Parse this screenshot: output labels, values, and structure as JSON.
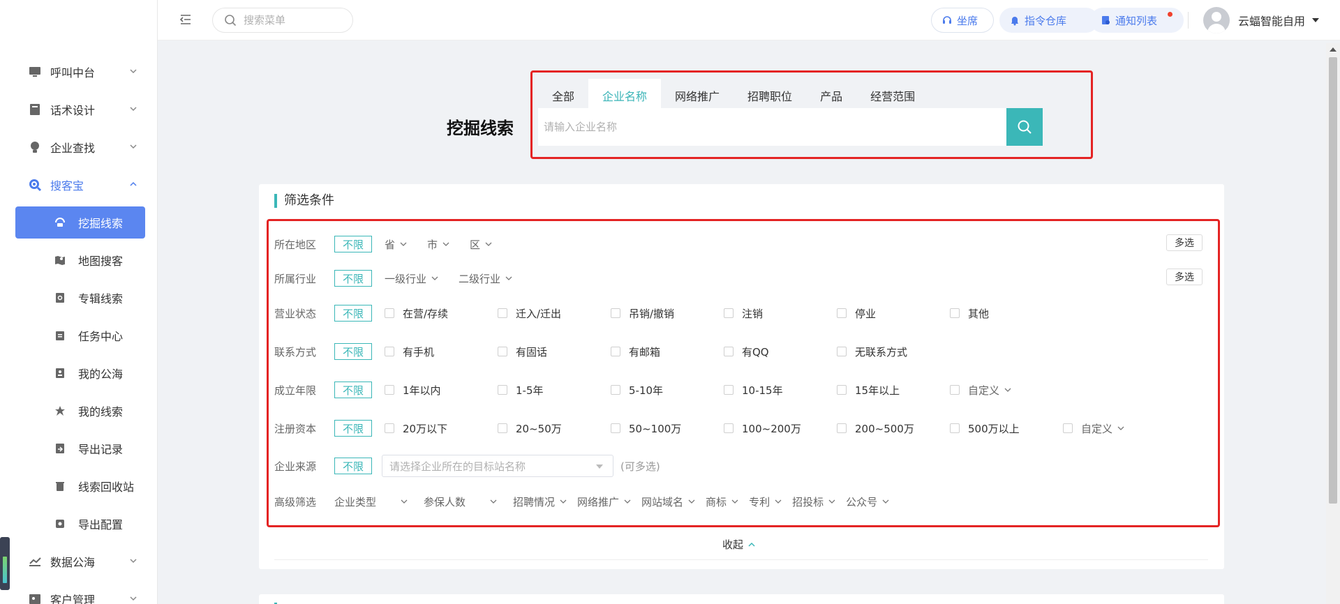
{
  "sidebar": {
    "menu": [
      {
        "label": "呼叫中台",
        "icon": "monitor-icon"
      },
      {
        "label": "话术设计",
        "icon": "book-icon"
      },
      {
        "label": "企业查找",
        "icon": "bulb-icon"
      },
      {
        "label": "搜客宝",
        "icon": "search-circle-icon",
        "open": true
      }
    ],
    "submenu": [
      {
        "label": "挖掘线索",
        "icon": "signal-icon",
        "active": true
      },
      {
        "label": "地图搜客",
        "icon": "map-icon"
      },
      {
        "label": "专辑线索",
        "icon": "doc-search-icon"
      },
      {
        "label": "任务中心",
        "icon": "clipboard-icon"
      },
      {
        "label": "我的公海",
        "icon": "contact-card-icon"
      },
      {
        "label": "我的线索",
        "icon": "star-icon"
      },
      {
        "label": "导出记录",
        "icon": "export-doc-icon"
      },
      {
        "label": "线索回收站",
        "icon": "trash-icon"
      },
      {
        "label": "导出配置",
        "icon": "config-icon"
      }
    ],
    "menu_after": [
      {
        "label": "数据公海",
        "icon": "chart-line-icon"
      },
      {
        "label": "客户管理",
        "icon": "customer-icon"
      }
    ]
  },
  "topbar": {
    "search_placeholder": "搜索菜单",
    "seat_label": "坐席",
    "command_label": "指令仓库",
    "notice_label": "通知列表",
    "username": "云蝠智能自用"
  },
  "hero": {
    "title": "挖掘线索",
    "tabs": [
      "全部",
      "企业名称",
      "网络推广",
      "招聘职位",
      "产品",
      "经营范围"
    ],
    "active_tab": "企业名称",
    "search_placeholder": "请输入企业名称"
  },
  "filters": {
    "title": "筛选条件",
    "unlimited": "不限",
    "multi_select": "多选",
    "region": {
      "label": "所在地区",
      "dropdowns": [
        "省",
        "市",
        "区"
      ]
    },
    "industry": {
      "label": "所属行业",
      "dropdowns": [
        "一级行业",
        "二级行业"
      ]
    },
    "status": {
      "label": "营业状态",
      "options": [
        "在营/存续",
        "迁入/迁出",
        "吊销/撤销",
        "注销",
        "停业",
        "其他"
      ]
    },
    "contact": {
      "label": "联系方式",
      "options": [
        "有手机",
        "有固话",
        "有邮箱",
        "有QQ",
        "无联系方式"
      ]
    },
    "years": {
      "label": "成立年限",
      "options": [
        "1年以内",
        "1-5年",
        "5-10年",
        "10-15年",
        "15年以上"
      ],
      "custom": "自定义"
    },
    "capital": {
      "label": "注册资本",
      "options": [
        "20万以下",
        "20~50万",
        "50~100万",
        "100~200万",
        "200~500万",
        "500万以上"
      ],
      "custom": "自定义"
    },
    "source": {
      "label": "企业来源",
      "placeholder": "请选择企业所在的目标站名称",
      "hint": "(可多选)"
    },
    "advanced": {
      "label": "高级筛选",
      "dropdowns": [
        "企业类型",
        "参保人数",
        "招聘情况",
        "网络推广",
        "网站域名",
        "商标",
        "专利",
        "招投标",
        "公众号"
      ]
    },
    "collapse_label": "收起"
  },
  "colors": {
    "accent": "#3bb7b8",
    "primary": "#5b86f0",
    "highlight_border": "#e42424"
  }
}
